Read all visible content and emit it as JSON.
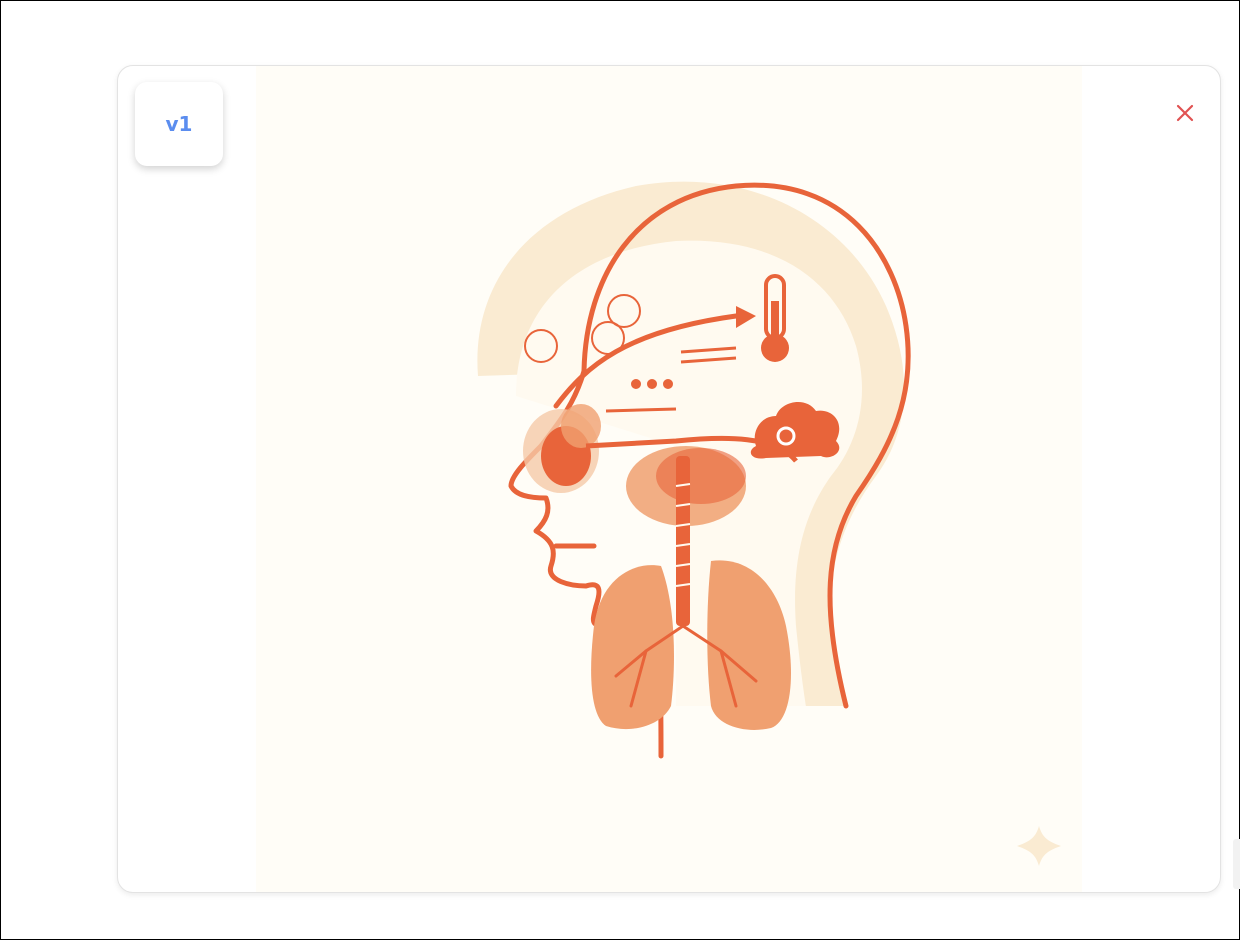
{
  "preview": {
    "version_label": "v1",
    "close_label": "close",
    "illustration_subject": "head-respiratory-tract-diagram"
  },
  "colors": {
    "accent_blue": "#5b8def",
    "close_red": "#e05252",
    "illustration_orange": "#e8643a",
    "illustration_light_orange": "#f0a070",
    "illustration_cream": "#faebd2",
    "panel_background": "#fffdf7"
  },
  "icons": {
    "close": "close-icon",
    "sparkle": "sparkle-icon",
    "thermometer": "thermometer-icon",
    "cloud": "cloud-icon"
  }
}
